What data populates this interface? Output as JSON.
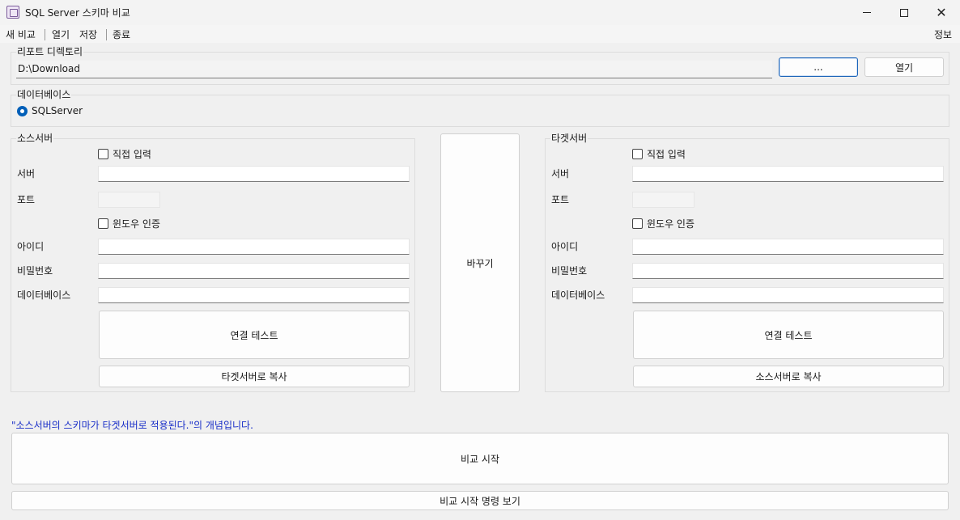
{
  "window": {
    "title": "SQL Server 스키마 비교",
    "minimize_glyph": "minimize-icon",
    "maximize_glyph": "maximize-icon",
    "close_glyph": "✕"
  },
  "menu": {
    "new_compare": "새 비교",
    "open": "열기",
    "save": "저장",
    "exit": "종료",
    "about": "정보"
  },
  "report": {
    "group_label": "리포트 디렉토리",
    "path": "D:\\Download",
    "browse_label": "...",
    "open_label": "열기"
  },
  "database": {
    "group_label": "데이터베이스",
    "option": "SQLServer",
    "selected": true
  },
  "source": {
    "group_label": "소스서버",
    "direct_input_label": "직접 입력",
    "server_label": "서버",
    "server_value": "",
    "port_label": "포트",
    "port_value": "",
    "windows_auth_label": "윈도우 인증",
    "id_label": "아이디",
    "id_value": "",
    "password_label": "비밀번호",
    "password_value": "",
    "database_label": "데이터베이스",
    "database_value": "",
    "test_button": "연결 테스트",
    "copy_button": "타겟서버로 복사"
  },
  "swap_button": "바꾸기",
  "target": {
    "group_label": "타겟서버",
    "direct_input_label": "직접 입력",
    "server_label": "서버",
    "server_value": "",
    "port_label": "포트",
    "port_value": "",
    "windows_auth_label": "윈도우 인증",
    "id_label": "아이디",
    "id_value": "",
    "password_label": "비밀번호",
    "password_value": "",
    "database_label": "데이터베이스",
    "database_value": "",
    "test_button": "연결 테스트",
    "copy_button": "소스서버로 복사"
  },
  "note": "\"소스서버의 스키마가 타겟서버로 적용된다.\"의 개념입니다.",
  "start_button": "비교 시작",
  "show_command_button": "비교 시작 명령 보기",
  "colors": {
    "accent": "#005fb8",
    "note_text": "#1a2fc8",
    "background": "#f0f0f0"
  }
}
